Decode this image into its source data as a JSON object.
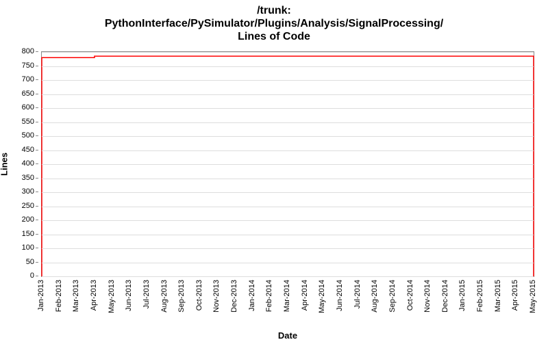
{
  "title_lines": [
    "/trunk:",
    "PythonInterface/PySimulator/Plugins/Analysis/SignalProcessing/",
    "Lines of Code"
  ],
  "ylabel": "Lines",
  "xlabel": "Date",
  "chart_data": {
    "type": "line",
    "ylim": [
      0,
      800
    ],
    "y_ticks": [
      0,
      50,
      100,
      150,
      200,
      250,
      300,
      350,
      400,
      450,
      500,
      550,
      600,
      650,
      700,
      750,
      800
    ],
    "x_categories": [
      "Jan-2013",
      "Feb-2013",
      "Mar-2013",
      "Apr-2013",
      "May-2013",
      "Jun-2013",
      "Jul-2013",
      "Aug-2013",
      "Sep-2013",
      "Oct-2013",
      "Nov-2013",
      "Dec-2013",
      "Jan-2014",
      "Feb-2014",
      "Mar-2014",
      "Apr-2014",
      "May-2014",
      "Jun-2014",
      "Jul-2014",
      "Aug-2014",
      "Sep-2014",
      "Oct-2014",
      "Nov-2014",
      "Dec-2014",
      "Jan-2015",
      "Feb-2015",
      "Mar-2015",
      "Apr-2015",
      "May-2015"
    ],
    "series": [
      {
        "name": "Lines of Code",
        "color": "#ff0000",
        "points": [
          {
            "x": "Jan-2013",
            "y": 0
          },
          {
            "x": "Jan-2013",
            "y": 780
          },
          {
            "x": "Apr-2013",
            "y": 780
          },
          {
            "x": "Apr-2013",
            "y": 785
          },
          {
            "x": "May-2015",
            "y": 785
          },
          {
            "x": "May-2015",
            "y": 0
          }
        ]
      }
    ]
  }
}
